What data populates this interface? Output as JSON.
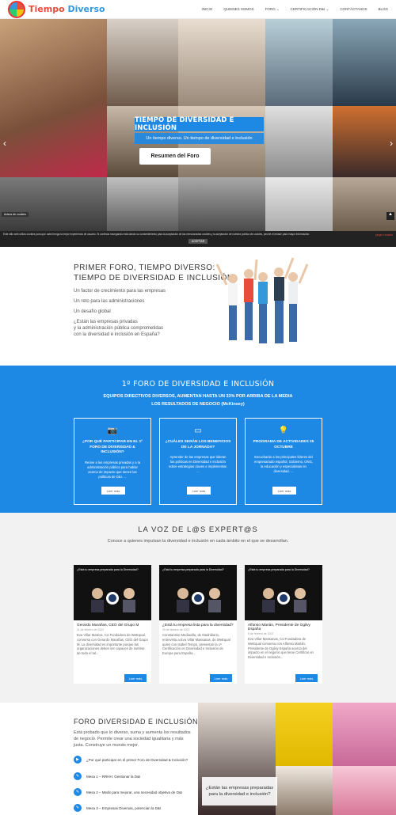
{
  "header": {
    "logo_part1": "Tiempo",
    "logo_part2": "Diverso",
    "nav": [
      "INICIO",
      "QUIENES SOMOS",
      "FORO ⌄",
      "CERTIFICACIÓN D&I ⌄",
      "CONTÁCTANOS",
      "BLOG"
    ]
  },
  "hero": {
    "title": "TIEMPO DE DIVERSIDAD E INCLUSIÓN",
    "subtitle": "Un tiempo diverso. Un tiempo de diversidad e inclusión",
    "button": "Resumen del Foro",
    "avisos": "Avisos de cookies",
    "prev": "‹",
    "next": "›",
    "scroll_top": "▲"
  },
  "cookie": {
    "text": "Este sitio web utiliza cookies para que usted tenga la mejor experiencia de usuario. Si continúa navegando está dando su consentimiento para la aceptación de las mencionadas cookies y la aceptación de nuestra política de cookies, pinche el enlace para mayor información.",
    "accept": "ACEPTAR",
    "more": "plugin cookies"
  },
  "section1": {
    "title_line1": "PRIMER FORO, TIEMPO DIVERSO:",
    "title_line2": "TIEMPO DE DIVERSIDAD E INCLUSIÓN",
    "items": [
      "Un factor de crecimiento para las empresas",
      "Un reto para las administraciones",
      "Un desafío global",
      "¿Están las empresas privadas",
      "y la administración pública comprometidas",
      "con la diversidad e inclusión en España?"
    ]
  },
  "section2": {
    "title": "1º FORO DE DIVERSIDAD E INCLUSIÓN",
    "sub1": "EQUIPOS DIRECTIVOS DIVERSOS, AUMENTAN HASTA UN 33% POR ARRIBA DE LA MEDIA",
    "sub2": "LOS RESULTADOS DE NEGOCIO (McKinsey)",
    "cards": [
      {
        "icon": "camera-icon",
        "glyph": "📷",
        "heading": "¿POR QUÉ PARTICIPAR EN EL 1º FORO DE DIVERSIDAD & INCLUSIÓN?",
        "text": "Reúne a las empresas privadas y a la administración pública para hablar acerca de impacto que tienen las políticas de D&I.   ...",
        "button": "Leer más"
      },
      {
        "icon": "tablet-icon",
        "glyph": "▭",
        "heading": "¿CUÁLES SERÁN LOS BENEFICIOS DE LA JORNADA?",
        "text": "Aprender de las empresas que lideran las políticas en Diversidad e Inclusión sobre estrategias claves e implementar. ...",
        "button": "Leer más"
      },
      {
        "icon": "lightbulb-icon",
        "glyph": "💡",
        "heading": "PROGRAMA DE ACTIVIDADES 25 OCTUBRE",
        "text": "Escucharás a los principales líderes del empresariado español, Gobierno, ONG, la educación y especialistas en diversidad. ...",
        "button": "Leer más"
      }
    ]
  },
  "section3": {
    "title": "LA VOZ DE L@S EXPERT@S",
    "subtitle": "Conoce a quienes impulsan la diversidad e inclusión en cada ámbito en el que se desarrollan.",
    "cards": [
      {
        "video_q": "¿Está tu empresa preparada para la Diversidad?",
        "title": "Gerardo Marañas, CEO del Grupo M",
        "date": "11 de febrero de 2022",
        "text": "Eva Villar Mateos, Co-Fundadora de WeEqual, conversa con Gerardo Marañas, CEO del Grupo M. La diversidad es importante porque las organizaciones deben ser capaces de nutrirse de todo el tal...",
        "button": "Leer más"
      },
      {
        "video_q": "¿Está tu empresa preparada para la Diversidad?",
        "title": "¿Está tu empresa lista para la diversidad?",
        "date": "25 de febrero de 2022",
        "text": "Constantino Mediavilla, de Madridiario, entrevista a Eva Villar Massanas, de WeEqual quien con Isabel Tempo, presentan la 1ª Certificación en Diversidad e Inclusión de Europa para España...",
        "button": "Leer más"
      },
      {
        "video_q": "¿Está tu empresa preparada para la Diversidad?",
        "title": "Alfonso Marián, Presidente de Ogilvy España",
        "date": "8 de febrero de 2022",
        "text": "Eva Villar Massanas, Co-Fundadora de WeEqual conversa con Alfonso Marián, Presidente de Ogilvy España acerca del impacto en el negocio que tiene Certificar en Diversidad e Inclusión...",
        "button": "Leer más"
      }
    ]
  },
  "section4": {
    "title": "FORO DIVERSIDAD E INCLUSIÓN",
    "text": "Está probado que lo diverso, suma y aumenta los resultados de negocio. Permite crear una sociedad igualitaria y más justa. Construye un mundo mejor.",
    "items": [
      "¿Por qué participar en el primer Foro de Diversidad & Inclusión?",
      "Mesa 1 – RRHH: Gestionar la D&I",
      "Mesa 2 – Medir para mejorar, una necesidad objetiva de D&I",
      "Mesa 3 – Empresas Diversas, potencian la D&I"
    ],
    "callout": "¿Están las empresas preparadas para la diversidad e inclusión?"
  }
}
